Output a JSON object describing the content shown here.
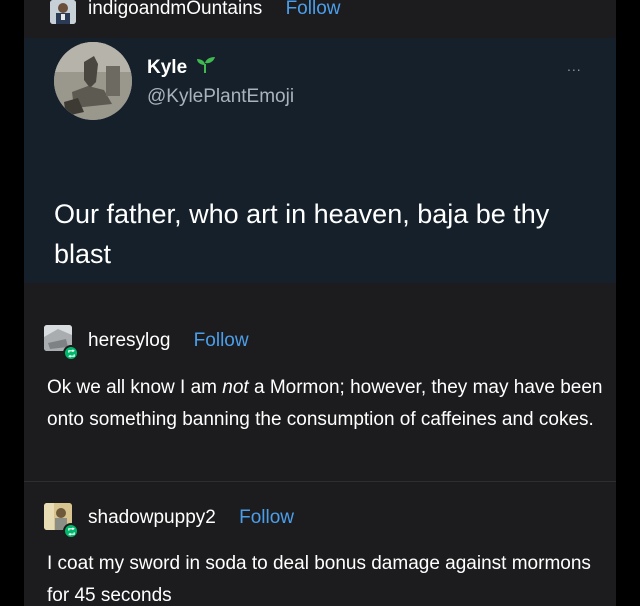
{
  "header": {
    "username": "indigoandmOuntains",
    "follow_label": "Follow"
  },
  "tweet": {
    "name": "Kyle",
    "handle": "@KylePlantEmoji",
    "more": "...",
    "text": "Our father, who art in heaven, baja be thy blast",
    "sprout_icon": "seedling-icon"
  },
  "reblogs": [
    {
      "username": "heresylog",
      "follow_label": "Follow",
      "text_before": "Ok we all know I am ",
      "text_italic": "not",
      "text_after": " a Mormon; however, they may have been onto something banning the consumption of caffeines and cokes."
    },
    {
      "username": "shadowpuppy2",
      "follow_label": "Follow",
      "text": "I coat my sword in soda to deal bonus damage against mormons for 45 seconds"
    }
  ],
  "colors": {
    "background": "#000000",
    "panel": "#1c1c1e",
    "tweet_bg": "#15202b",
    "follow": "#4b9eea",
    "reblog_badge": "#00b86b",
    "sprout": "#3fb950"
  }
}
